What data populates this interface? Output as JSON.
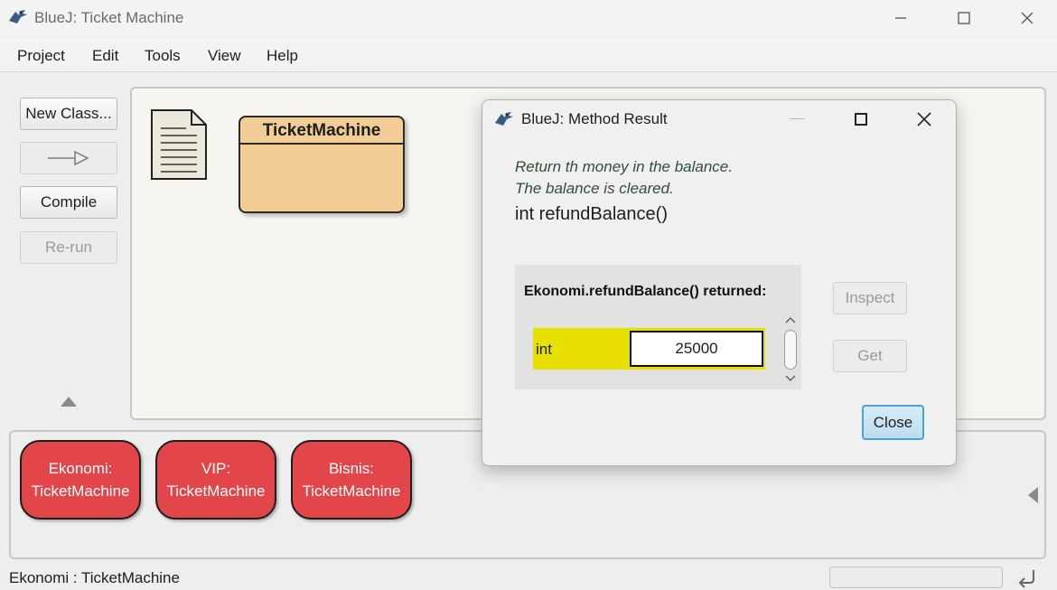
{
  "window": {
    "title": "BlueJ:  Ticket Machine"
  },
  "menu": [
    "Project",
    "Edit",
    "Tools",
    "View",
    "Help"
  ],
  "toolbar": {
    "new_class": "New Class...",
    "compile": "Compile",
    "rerun": "Re-run"
  },
  "diagram": {
    "class_name": "TicketMachine"
  },
  "object_bench": [
    {
      "name": "Ekonomi:",
      "type": "TicketMachine"
    },
    {
      "name": "VIP:",
      "type": "TicketMachine"
    },
    {
      "name": "Bisnis:",
      "type": "TicketMachine"
    }
  ],
  "status": {
    "text": "Ekonomi : TicketMachine"
  },
  "dialog": {
    "title": "BlueJ:  Method Result",
    "comment_line1": "Return th money in the balance.",
    "comment_line2": "The balance is cleared.",
    "signature": "int refundBalance()",
    "result_label": "Ekonomi.refundBalance() returned:",
    "result_type": "int",
    "result_value": "25000",
    "inspect_label": "Inspect",
    "get_label": "Get",
    "close_label": "Close"
  },
  "colors": {
    "class_fill": "#f1cc94",
    "object_fill": "#e3464a",
    "result_highlight": "#e7e000",
    "focus_border": "#4aa3d8"
  }
}
